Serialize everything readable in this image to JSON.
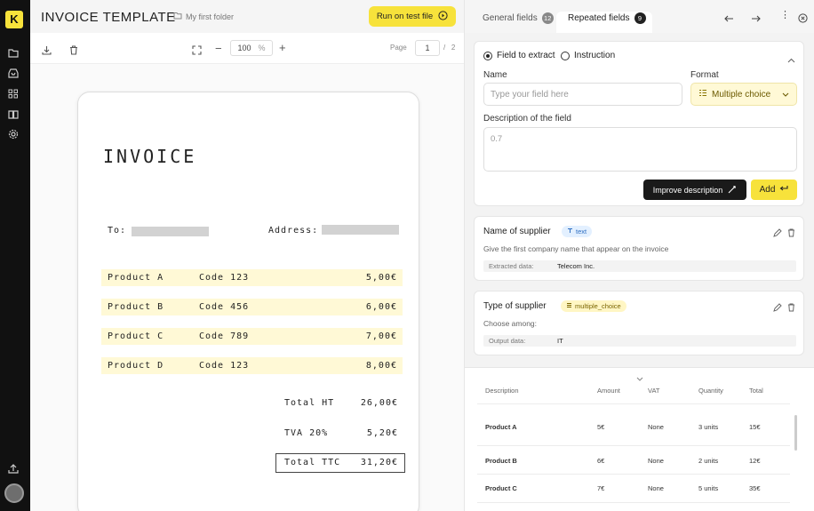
{
  "app": {
    "logo_letter": "K",
    "accent": "#f7e23b"
  },
  "sidebar": {
    "icons": [
      "folder-icon",
      "inbox-icon",
      "apps-icon",
      "book-icon",
      "settings-icon"
    ],
    "bottom_icons": [
      "upload-icon",
      "avatar"
    ]
  },
  "document": {
    "title": "INVOICE TEMPLATE",
    "folder": "My first folder",
    "run_button": "Run on test file"
  },
  "toolbar": {
    "zoom": "100",
    "zoom_unit": "%",
    "page_label": "Page",
    "page_current": "1",
    "page_separator": "/",
    "page_total": "2"
  },
  "invoice": {
    "title": "INVOICE",
    "to_label": "To:",
    "address_label": "Address:",
    "rows": [
      {
        "product": "Product A",
        "code": "Code 123",
        "amount": "5,00€"
      },
      {
        "product": "Product B",
        "code": "Code 456",
        "amount": "6,00€"
      },
      {
        "product": "Product C",
        "code": "Code 789",
        "amount": "7,00€"
      },
      {
        "product": "Product D",
        "code": "Code 123",
        "amount": "8,00€"
      }
    ],
    "totals": [
      {
        "label": "Total HT",
        "value": "26,00€"
      },
      {
        "label": "TVA 20%",
        "value": "5,20€"
      },
      {
        "label": "Total TTC",
        "value": "31,20€"
      }
    ]
  },
  "tabs": [
    {
      "label": "General fields",
      "count": "12"
    },
    {
      "label": "Repeated fields",
      "count": "9"
    }
  ],
  "form": {
    "radio_extract": "Field to extract",
    "radio_instruction": "Instruction",
    "name_label": "Name",
    "name_placeholder": "Type your field here",
    "format_label": "Format",
    "format_value": "Multiple choice",
    "description_label": "Description of the field",
    "description_value": "0.7",
    "improve_button": "Improve description",
    "add_button": "Add"
  },
  "fields": [
    {
      "title": "Name of supplier",
      "type": "text",
      "description": "Give the first company name that appear on the invoice",
      "data_label": "Extracted data:",
      "data_value": "Telecom Inc."
    },
    {
      "title": "Type of supplier",
      "type": "multiple_choice",
      "description": "Choose among:",
      "data_label": "Output data:",
      "data_value": "IT"
    }
  ],
  "table": {
    "headers": [
      "Description",
      "Amount",
      "VAT",
      "Quantity",
      "Total"
    ],
    "rows": [
      [
        "Product A",
        "5€",
        "None",
        "3 units",
        "15€"
      ],
      [
        "Product B",
        "6€",
        "None",
        "2 units",
        "12€"
      ],
      [
        "Product C",
        "7€",
        "None",
        "5 units",
        "35€"
      ]
    ]
  }
}
